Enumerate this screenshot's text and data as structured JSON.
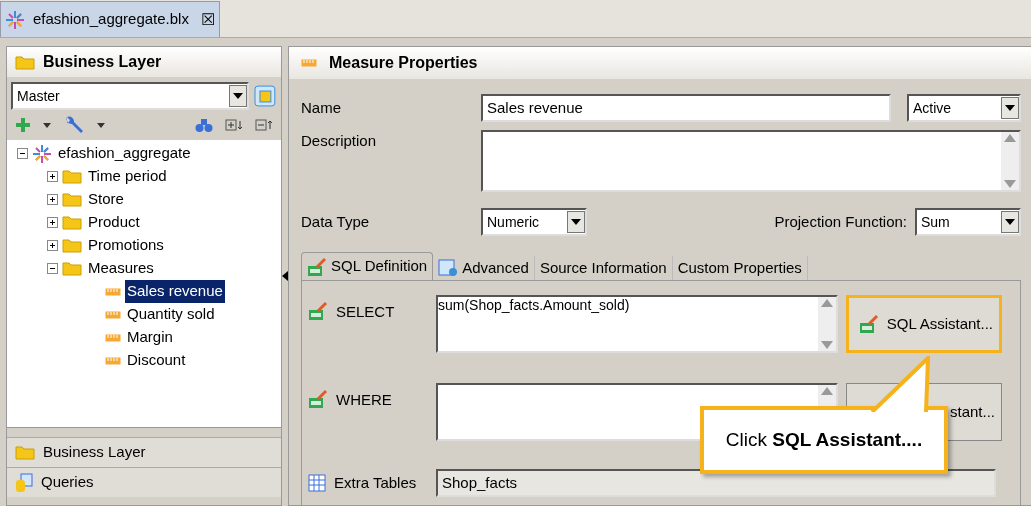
{
  "editor_tab": {
    "title": "efashion_aggregate.blx",
    "close": "☒"
  },
  "left_panel": {
    "title": "Business Layer",
    "view_select": {
      "value": "Master"
    },
    "tree": [
      {
        "label": "efashion_aggregate",
        "kind": "universe",
        "expanded": true,
        "selected": false,
        "children": [
          {
            "label": "Time period",
            "kind": "folder",
            "expanded": false,
            "selected": false
          },
          {
            "label": "Store",
            "kind": "folder",
            "expanded": false,
            "selected": false
          },
          {
            "label": "Product",
            "kind": "folder",
            "expanded": false,
            "selected": false
          },
          {
            "label": "Promotions",
            "kind": "folder",
            "expanded": false,
            "selected": false
          },
          {
            "label": "Measures",
            "kind": "folder",
            "expanded": true,
            "selected": false,
            "children": [
              {
                "label": "Sales revenue",
                "kind": "measure",
                "selected": true
              },
              {
                "label": "Quantity sold",
                "kind": "measure",
                "selected": false
              },
              {
                "label": "Margin",
                "kind": "measure",
                "selected": false
              },
              {
                "label": "Discount",
                "kind": "measure",
                "selected": false
              }
            ]
          }
        ]
      }
    ],
    "bottom_tabs": [
      {
        "label": "Business Layer",
        "kind": "folder"
      },
      {
        "label": "Queries",
        "kind": "queries"
      }
    ]
  },
  "properties": {
    "title": "Measure Properties",
    "name": {
      "label": "Name",
      "value": "Sales revenue",
      "state": "Active"
    },
    "description": {
      "label": "Description"
    },
    "data_type": {
      "label": "Data Type",
      "value": "Numeric"
    },
    "projection": {
      "label": "Projection Function:",
      "value": "Sum"
    },
    "tabs": [
      {
        "label": "SQL Definition",
        "selected": true,
        "kind": "sql"
      },
      {
        "label": "Advanced",
        "selected": false,
        "kind": "advanced"
      },
      {
        "label": "Source Information",
        "selected": false
      },
      {
        "label": "Custom Properties",
        "selected": false
      }
    ],
    "select": {
      "label": "SELECT",
      "value": "sum(Shop_facts.Amount_sold)",
      "button": "SQL Assistant...",
      "highlighted": true
    },
    "where": {
      "label": "WHERE",
      "button": "stant...",
      "highlighted": false
    },
    "extra_tables": {
      "label": "Extra Tables",
      "value": "Shop_facts"
    }
  },
  "callout": {
    "prefix": "Click ",
    "bold": "SQL Assistant...."
  }
}
